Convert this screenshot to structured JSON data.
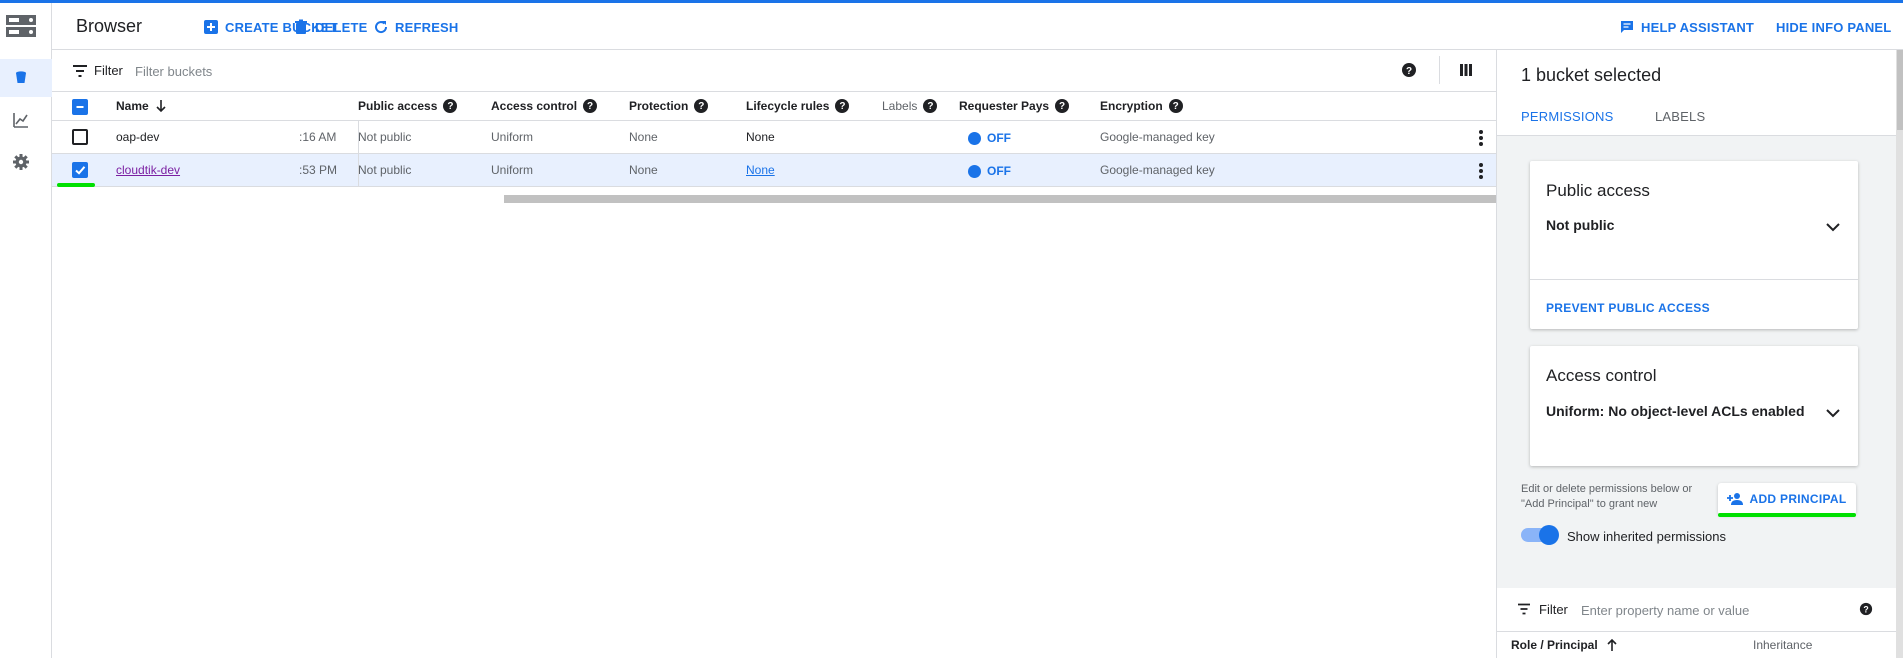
{
  "header": {
    "title": "Browser",
    "create_bucket": "CREATE BUCKET",
    "delete": "DELETE",
    "refresh": "REFRESH",
    "help_assistant": "HELP ASSISTANT",
    "hide_info_panel": "HIDE INFO PANEL"
  },
  "filter": {
    "label": "Filter",
    "placeholder": "Filter buckets"
  },
  "table": {
    "columns": {
      "name": "Name",
      "public_access": "Public access",
      "access_control": "Access control",
      "protection": "Protection",
      "lifecycle_rules": "Lifecycle rules",
      "labels": "Labels",
      "requester_pays": "Requester Pays",
      "encryption": "Encryption"
    },
    "rows": [
      {
        "name": ":16 AM",
        "bucket": "oap-dev",
        "created": ":16 AM",
        "public_access": "Not public",
        "access_control": "Uniform",
        "protection": "None",
        "lifecycle": "None",
        "requester_pays": "OFF",
        "encryption": "Google-managed key",
        "selected": false
      },
      {
        "bucket": "cloudtik-dev",
        "created": ":53 PM",
        "public_access": "Not public",
        "access_control": "Uniform",
        "protection": "None",
        "lifecycle": "None",
        "requester_pays": "OFF",
        "encryption": "Google-managed key",
        "selected": true
      }
    ]
  },
  "panel": {
    "title": "1 bucket selected",
    "tabs": [
      "PERMISSIONS",
      "LABELS"
    ],
    "public_access": {
      "title": "Public access",
      "value": "Not public",
      "action": "PREVENT PUBLIC ACCESS"
    },
    "access_control": {
      "title": "Access control",
      "value": "Uniform: No object-level ACLs enabled"
    },
    "help_text": "Edit or delete permissions below or \"Add Principal\" to grant new",
    "add_principal": "ADD PRINCIPAL",
    "show_inherited": "Show inherited permissions",
    "filter_label": "Filter",
    "filter_placeholder": "Enter property name or value",
    "col_role": "Role / Principal",
    "col_inheritance": "Inheritance"
  },
  "colors": {
    "accent": "#1a73e8",
    "highlight": "#00e000",
    "visited_link": "#7b1fa2"
  }
}
